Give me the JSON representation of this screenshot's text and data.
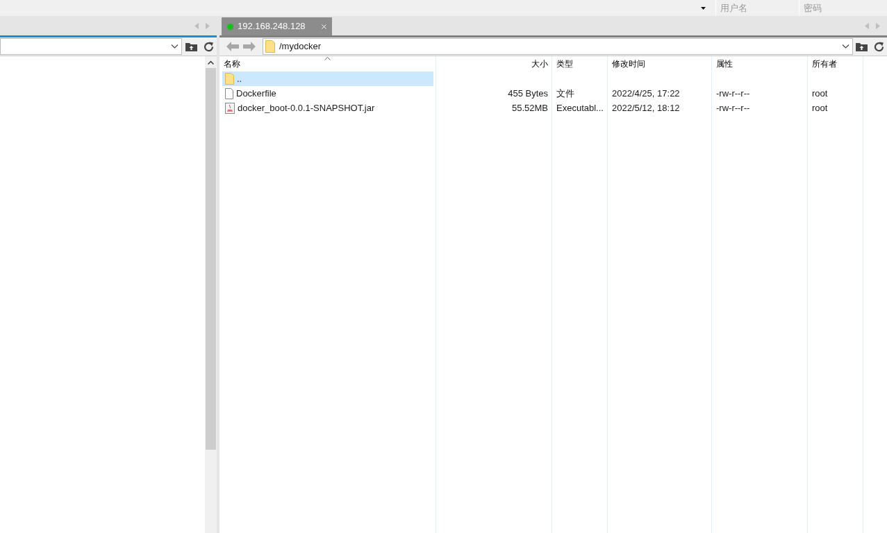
{
  "top_bar": {
    "username_field": {
      "placeholder": "用户名"
    },
    "password_field": {
      "placeholder": "密码"
    }
  },
  "session_tabs": [
    {
      "label": "192.168.248.128",
      "connected": true,
      "selected": true
    }
  ],
  "remote_pane": {
    "path": "/mydocker",
    "columns": [
      "名称",
      "大小",
      "类型",
      "修改时间",
      "属性",
      "所有者"
    ],
    "rows": [
      {
        "kind": "folder",
        "name": "..",
        "selected": true
      },
      {
        "kind": "file",
        "name": "Dockerfile",
        "size": "455 Bytes",
        "type": "文件",
        "modified": "2022/4/25, 17:22",
        "permissions": "-rw-r--r--",
        "owner": "root",
        "selected": false
      },
      {
        "kind": "jar",
        "name": "docker_boot-0.0.1-SNAPSHOT.jar",
        "size": "55.52MB",
        "type": "Executabl...",
        "modified": "2022/5/12, 18:12",
        "permissions": "-rw-r--r--",
        "owner": "root",
        "selected": false
      }
    ]
  }
}
